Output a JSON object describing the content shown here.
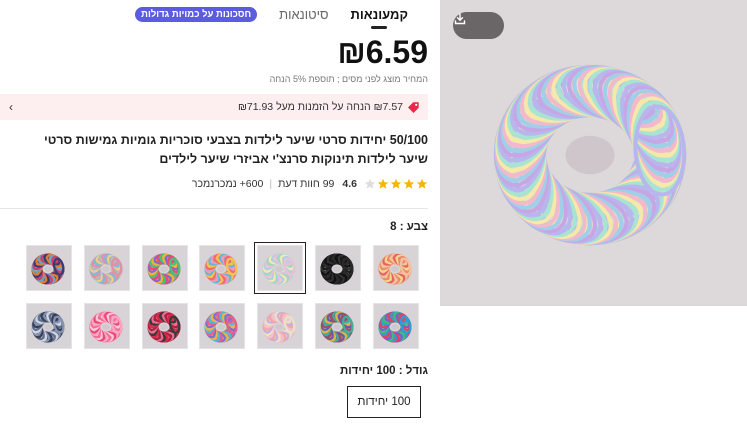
{
  "tabs": [
    {
      "label": "קמעונאות",
      "active": true
    },
    {
      "label": "סיטונאות",
      "active": false
    }
  ],
  "promo_badge": "חסכונות על כמויות גדולות",
  "price": "₪6.59",
  "tax_note": "המחיר מוצג לפני מסים ; תוספת 5% הנחה",
  "coupon": {
    "text": "₪7.57 הנחה על הזמנות מעל ₪71.93",
    "icon": "coupon-tag-icon",
    "accent": "#e8294b"
  },
  "product_title": "50/100 יחידות סרטי שיער לילדות בצבעי סוכריות גומיות גמישות סרטי שיער לילדות תינוקות סרנצ'י אביזרי שיער לילדים",
  "rating": {
    "score": "4.6",
    "stars": 4.6,
    "reviews": "99 חוות דעת",
    "sold": "600+ נמכרנמכר",
    "star_color": "#f7b500"
  },
  "color_label": "צבע : 8",
  "swatches": [
    {
      "name": "swatch-1",
      "palette": [
        "#e98d6e",
        "#f2c1a0",
        "#e46464",
        "#f6d88a"
      ]
    },
    {
      "name": "swatch-2",
      "palette": [
        "#1b1b1b",
        "#2a2a2a",
        "#111111",
        "#333333"
      ]
    },
    {
      "name": "swatch-3",
      "palette": [
        "#b9c9e6",
        "#e7c3d5",
        "#9fd6c6",
        "#f1eab1"
      ],
      "selected": true
    },
    {
      "name": "swatch-4",
      "palette": [
        "#ef6b6b",
        "#f4c54b",
        "#5fb6e5",
        "#f296c6"
      ]
    },
    {
      "name": "swatch-5",
      "palette": [
        "#e94c6f",
        "#48c27a",
        "#f3b237",
        "#8c62d9"
      ]
    },
    {
      "name": "swatch-6",
      "palette": [
        "#b0b7bf",
        "#e28fa8",
        "#86b6d8",
        "#f0cf83"
      ]
    },
    {
      "name": "swatch-7",
      "palette": [
        "#cc3e6a",
        "#3b3b72",
        "#e27f2b",
        "#6aa3c9"
      ]
    },
    {
      "name": "swatch-8",
      "palette": [
        "#e0445f",
        "#2a9fd6",
        "#3dbd78",
        "#9054c9"
      ]
    },
    {
      "name": "swatch-9",
      "palette": [
        "#9c4f6e",
        "#3fae9a",
        "#e0b249",
        "#6a5aa6"
      ]
    },
    {
      "name": "swatch-10",
      "palette": [
        "#f0c4cf",
        "#e9e2c8",
        "#c8b0dc",
        "#f7a6a6"
      ]
    },
    {
      "name": "swatch-11",
      "palette": [
        "#7c6fd3",
        "#e85f8d",
        "#4dbbd8",
        "#f5b244"
      ]
    },
    {
      "name": "swatch-12",
      "palette": [
        "#d32f4d",
        "#3a3a3a",
        "#e76f96",
        "#b51e3a"
      ]
    },
    {
      "name": "swatch-13",
      "palette": [
        "#f26f9a",
        "#f9a7c0",
        "#e8497b",
        "#fcc8d8"
      ]
    },
    {
      "name": "swatch-14",
      "palette": [
        "#3a3f55",
        "#8593b3",
        "#d3d6e1",
        "#5f6f8f"
      ]
    }
  ],
  "size_label": "גודל : 100 יחידות",
  "size_option": "100 יחידות",
  "download_icon": "download-icon",
  "hero_palette": [
    "#c7a6e6",
    "#9fd0e8",
    "#f2b8cc",
    "#f5e8a8",
    "#a8e4d2",
    "#b9b6ee"
  ]
}
